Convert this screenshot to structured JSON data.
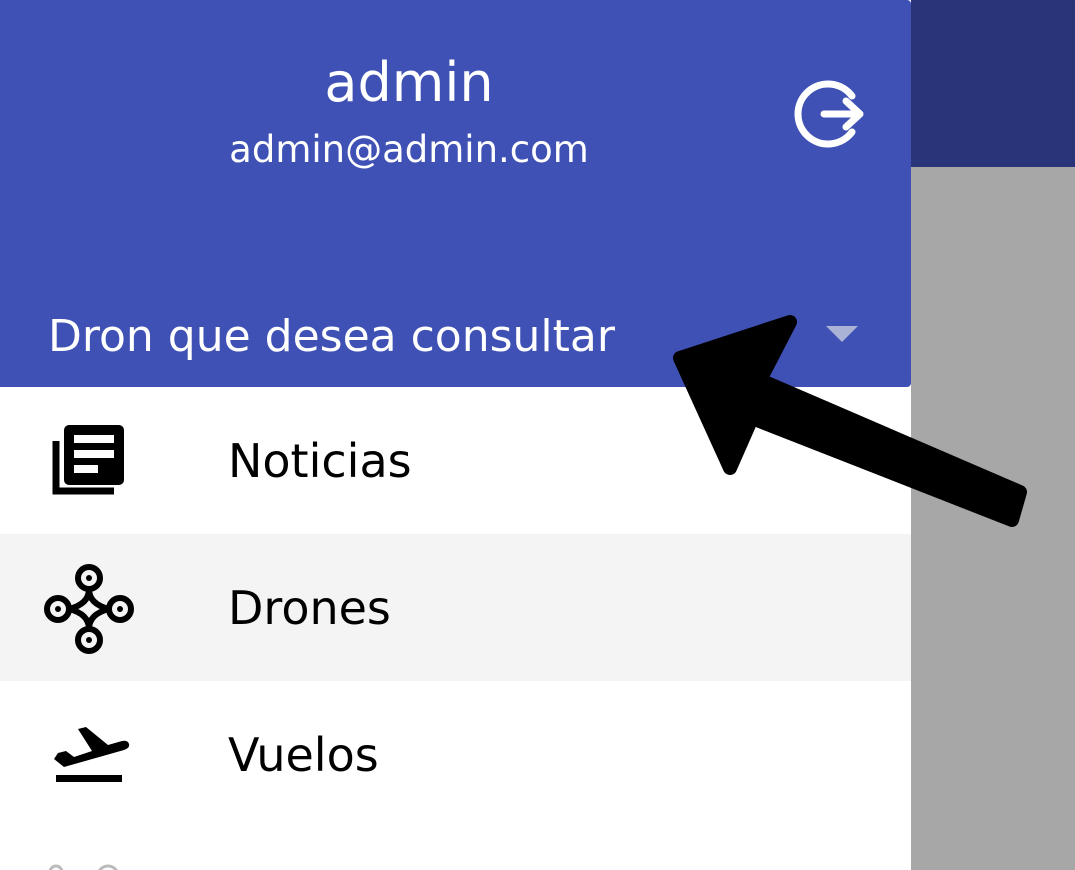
{
  "drawer": {
    "user": {
      "name": "admin",
      "email": "admin@admin.com"
    },
    "drone_select": {
      "label": "Dron que desea consultar"
    },
    "menu": [
      {
        "label": "Noticias",
        "icon": "newspaper-icon"
      },
      {
        "label": "Drones",
        "icon": "drone-icon",
        "active": true
      },
      {
        "label": "Vuelos",
        "icon": "flight-takeoff-icon"
      }
    ]
  },
  "colors": {
    "header": "#3f51b5",
    "appbar": "#2a3478",
    "scrim": "#a7a7a7",
    "active_item": "#f4f4f4"
  }
}
